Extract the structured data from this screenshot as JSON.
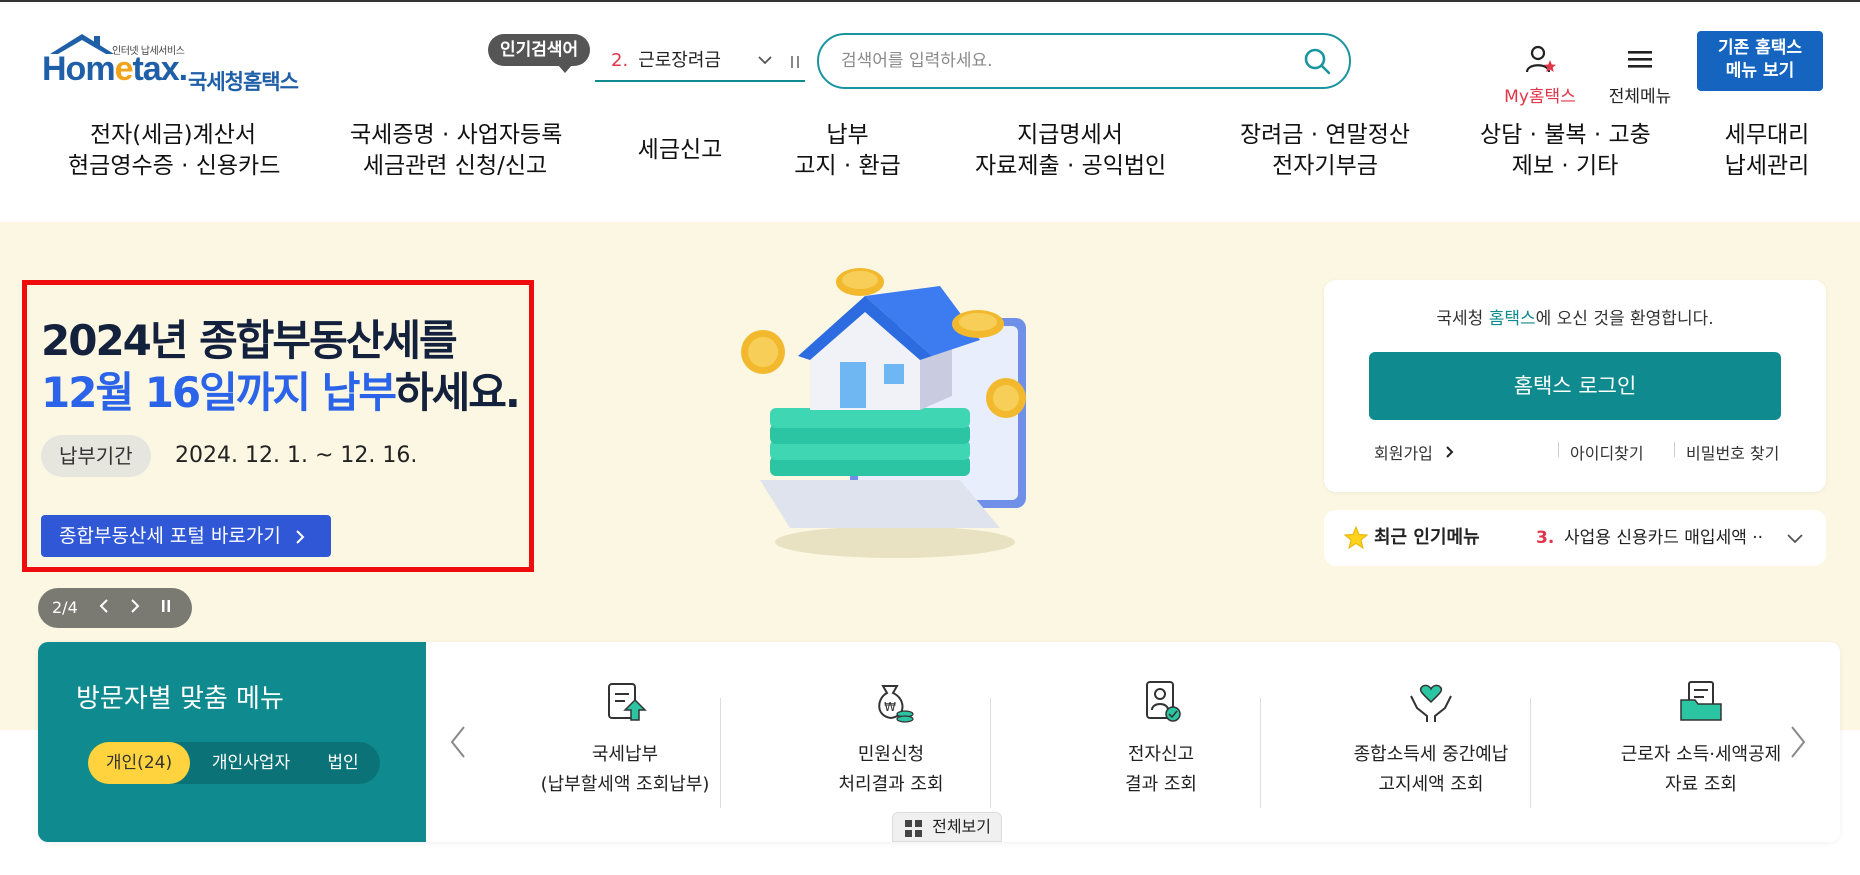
{
  "header": {
    "logo": {
      "small": "인터넷 납세서비스",
      "word_pre": "Hom",
      "word_e": "e",
      "word_post": "tax.",
      "kor": "국세청홈택스"
    },
    "popular": {
      "badge": "인기검색어",
      "rank": "2.",
      "term": "근로장려금"
    },
    "search": {
      "placeholder": "검색어를 입력하세요."
    },
    "my_label": "My홈택스",
    "all_menu_label": "전체메뉴",
    "old_menu": {
      "line1": "기존 홈택스",
      "line2": "메뉴 보기"
    }
  },
  "gnb": [
    {
      "l1": "전자(세금)계산서",
      "l2": "현금영수증 · 신용카드"
    },
    {
      "l1": "국세증명 · 사업자등록",
      "l2": "세금관련 신청/신고"
    },
    {
      "l1": "세금신고",
      "l2": ""
    },
    {
      "l1": "납부",
      "l2": "고지 · 환급"
    },
    {
      "l1": "지급명세서",
      "l2": "자료제출 · 공익법인"
    },
    {
      "l1": "장려금 · 연말정산",
      "l2": "전자기부금"
    },
    {
      "l1": "상담 · 불복 · 고충",
      "l2": "제보 · 기타"
    },
    {
      "l1": "세무대리",
      "l2": "납세관리"
    }
  ],
  "banner": {
    "line1": "2024년 종합부동산세를",
    "line2_blue": "12월 16일까지 납부",
    "line2_dark": "하세요.",
    "period_label": "납부기간",
    "period_value": "2024. 12. 1. ~ 12. 16.",
    "portal_button": "종합부동산세 포털 바로가기",
    "pager": "2/4"
  },
  "login": {
    "welcome_pre": "국세청 ",
    "welcome_hl": "홈택스",
    "welcome_post": "에 오신 것을 환영합니다.",
    "button": "홈택스 로그인",
    "join": "회원가입",
    "find_id": "아이디찾기",
    "find_pw": "비밀번호 찾기"
  },
  "popular_menu": {
    "label": "최근 인기메뉴",
    "rank": "3.",
    "item": "사업용 신용카드 매입세액 ··"
  },
  "visitor": {
    "title": "방문자별 맞춤 메뉴",
    "tabs": [
      "개인(24)",
      "개인사업자",
      "법인"
    ],
    "services": [
      {
        "t1": "국세납부",
        "t2": "(납부할세액 조회납부)",
        "icon": "tax-payment-icon"
      },
      {
        "t1": "민원신청",
        "t2": "처리결과 조회",
        "icon": "money-bag-icon"
      },
      {
        "t1": "전자신고",
        "t2": "결과 조회",
        "icon": "e-filing-icon"
      },
      {
        "t1": "종합소득세 중간예납",
        "t2": "고지세액 조회",
        "icon": "heart-hands-icon"
      },
      {
        "t1": "근로자 소득·세액공제",
        "t2": "자료 조회",
        "icon": "folder-doc-icon"
      }
    ],
    "view_all": "전체보기"
  },
  "colors": {
    "teal": "#0f8a8e",
    "blue": "#2b64e8",
    "red": "#e0364a",
    "cream": "#fbf7e3"
  }
}
